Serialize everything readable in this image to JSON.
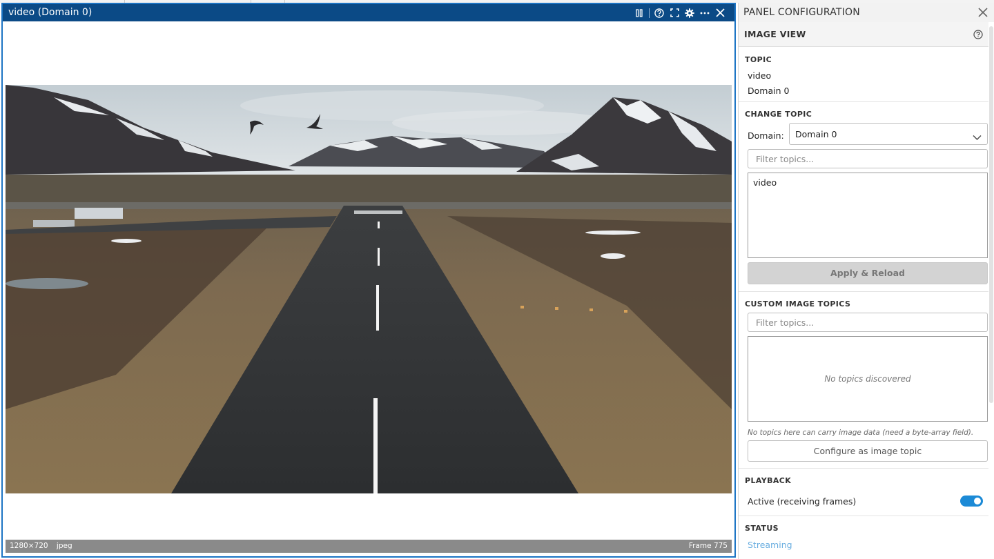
{
  "video_panel": {
    "title": "video (Domain 0)",
    "icons": [
      "pause-icon",
      "help-icon",
      "fullscreen-icon",
      "settings-icon",
      "more-icon",
      "close-icon"
    ],
    "status_resolution": "1280×720",
    "status_format": "jpeg",
    "status_frame": "Frame 775",
    "accent_color": "#0b4a86"
  },
  "config_panel": {
    "title": "PANEL CONFIGURATION",
    "section_title": "IMAGE VIEW",
    "topic": {
      "label": "TOPIC",
      "name": "video",
      "domain": "Domain 0"
    },
    "change_topic": {
      "label": "CHANGE TOPIC",
      "domain_label": "Domain:",
      "domain_selected": "Domain 0",
      "filter_placeholder": "Filter topics...",
      "topics": [
        "video"
      ],
      "apply_label": "Apply & Reload"
    },
    "custom_image_topics": {
      "label": "CUSTOM IMAGE TOPICS",
      "filter_placeholder": "Filter topics...",
      "empty_text": "No topics discovered",
      "hint": "No topics here can carry image data (need a byte-array field).",
      "configure_label": "Configure as image topic"
    },
    "playback": {
      "label": "PLAYBACK",
      "active_label": "Active (receiving frames)",
      "active": true
    },
    "status": {
      "label": "STATUS",
      "value": "Streaming"
    }
  }
}
